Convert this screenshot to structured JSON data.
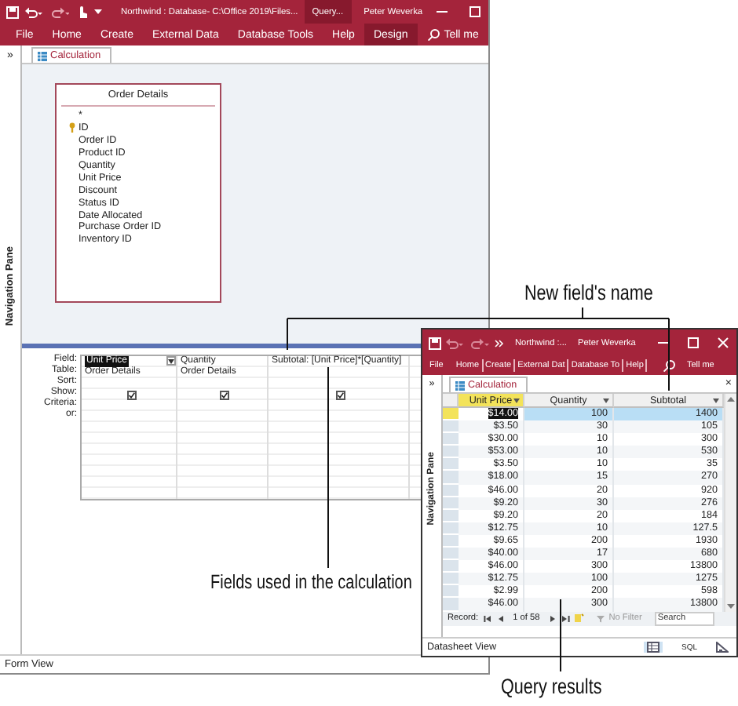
{
  "back_window": {
    "title": "Northwind : Database- C:\\Office 2019\\Files...",
    "context_tab": "Query...",
    "user": "Peter Weverka",
    "menu": [
      {
        "label": "File",
        "selected": false
      },
      {
        "label": "Home",
        "selected": false
      },
      {
        "label": "Create",
        "selected": false
      },
      {
        "label": "External Data",
        "selected": false
      },
      {
        "label": "Database Tools",
        "selected": false
      },
      {
        "label": "Help",
        "selected": false
      },
      {
        "label": "Design",
        "selected": true
      }
    ],
    "tell_me": "Tell me",
    "nav_toggle": "»",
    "nav_pane": "Navigation Pane",
    "document_tab": "Calculation",
    "table": {
      "title": "Order Details",
      "fields": [
        {
          "name": "*",
          "key": false
        },
        {
          "name": "ID",
          "key": true
        },
        {
          "name": "Order ID",
          "key": false
        },
        {
          "name": "Product ID",
          "key": false
        },
        {
          "name": "Quantity",
          "key": false
        },
        {
          "name": "Unit Price",
          "key": false
        },
        {
          "name": "Discount",
          "key": false
        },
        {
          "name": "Status ID",
          "key": false
        },
        {
          "name": "Date Allocated",
          "key": false
        },
        {
          "name": "Purchase Order ID",
          "key": false
        },
        {
          "name": "Inventory ID",
          "key": false
        }
      ]
    },
    "grid": {
      "row_labels": [
        "Field:",
        "Table:",
        "Sort:",
        "Show:",
        "Criteria:",
        "or:"
      ],
      "columns": [
        {
          "field": "Unit Price",
          "table": "Order Details",
          "show": true,
          "selected": true
        },
        {
          "field": "Quantity",
          "table": "Order Details",
          "show": true,
          "selected": false
        },
        {
          "field": "Subtotal: [Unit Price]*[Quantity]",
          "show": true,
          "selected": false
        }
      ]
    },
    "status_bar": "Form View"
  },
  "front_window": {
    "title": "Northwind :...",
    "user": "Peter Weverka",
    "menu": [
      "File",
      "Home",
      "Create",
      "External Dat",
      "Database To",
      "Help"
    ],
    "tell_me": "Tell me",
    "nav_toggle": "»",
    "nav_pane": "Navigation Pane",
    "document_tab": "Calculation",
    "close_tab": "×",
    "datasheet": {
      "columns": [
        {
          "label": "Unit Price",
          "selected": true
        },
        {
          "label": "Quantity",
          "selected": false
        },
        {
          "label": "Subtotal",
          "selected": false
        }
      ],
      "rows": [
        {
          "cells": [
            "$14.00",
            "100",
            "1400"
          ],
          "selected": true
        },
        {
          "cells": [
            "$3.50",
            "30",
            "105"
          ],
          "selected": false
        },
        {
          "cells": [
            "$30.00",
            "10",
            "300"
          ],
          "selected": false
        },
        {
          "cells": [
            "$53.00",
            "10",
            "530"
          ],
          "selected": false
        },
        {
          "cells": [
            "$3.50",
            "10",
            "35"
          ],
          "selected": false
        },
        {
          "cells": [
            "$18.00",
            "15",
            "270"
          ],
          "selected": false
        },
        {
          "cells": [
            "$46.00",
            "20",
            "920"
          ],
          "selected": false
        },
        {
          "cells": [
            "$9.20",
            "30",
            "276"
          ],
          "selected": false
        },
        {
          "cells": [
            "$9.20",
            "20",
            "184"
          ],
          "selected": false
        },
        {
          "cells": [
            "$12.75",
            "10",
            "127.5"
          ],
          "selected": false
        },
        {
          "cells": [
            "$9.65",
            "200",
            "1930"
          ],
          "selected": false
        },
        {
          "cells": [
            "$40.00",
            "17",
            "680"
          ],
          "selected": false
        },
        {
          "cells": [
            "$46.00",
            "300",
            "13800"
          ],
          "selected": false
        },
        {
          "cells": [
            "$12.75",
            "100",
            "1275"
          ],
          "selected": false
        },
        {
          "cells": [
            "$2.99",
            "200",
            "598"
          ],
          "selected": false
        },
        {
          "cells": [
            "$46.00",
            "300",
            "13800"
          ],
          "selected": false
        }
      ]
    },
    "record_nav": {
      "label": "Record:",
      "position": "1 of 58",
      "filter": "No Filter",
      "search_placeholder": "Search"
    },
    "status_bar": {
      "text": "Datasheet View",
      "sql": "SQL"
    }
  },
  "callouts": [
    {
      "text": "New field's name"
    },
    {
      "text": "Fields used in the calculation"
    },
    {
      "text": "Query results"
    }
  ]
}
